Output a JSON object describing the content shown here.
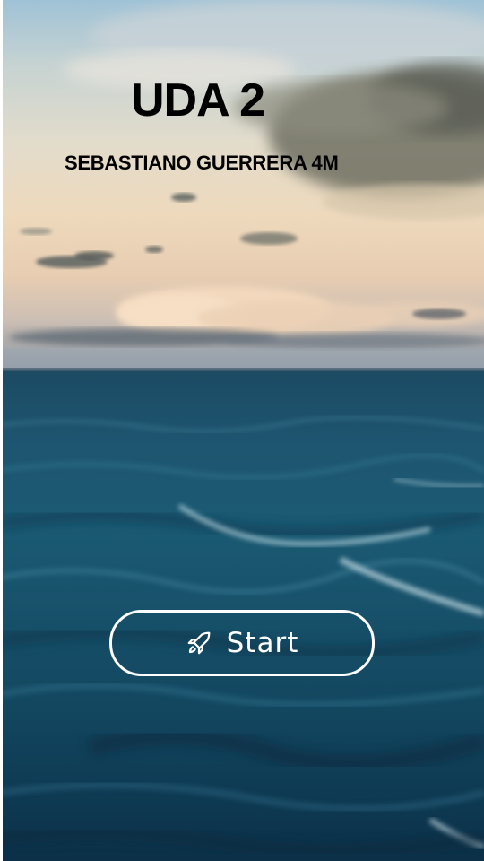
{
  "header": {
    "title": "UDA 2",
    "subtitle": "SEBASTIANO GUERRERA 4M"
  },
  "start_button": {
    "label": "Start",
    "icon": "rocket-icon"
  },
  "colors": {
    "title_text": "#000000",
    "button_border": "#ffffff",
    "button_text": "#ffffff",
    "sea_dark": "#0b3048",
    "sky_light": "#e2dccb"
  }
}
